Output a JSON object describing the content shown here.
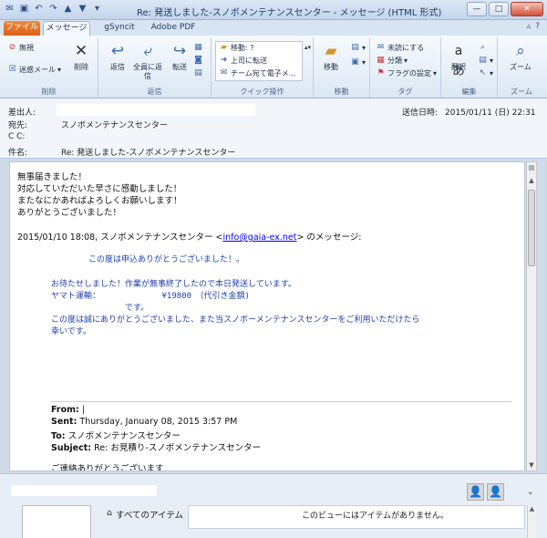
{
  "window": {
    "title": "Re: 発送しました-スノボメンテナンスセンター - メッセージ (HTML 形式)"
  },
  "tabs": {
    "file": "ファイル",
    "message": "メッセージ",
    "gsyncit": "gSyncit",
    "adobe": "Adobe PDF"
  },
  "ribbon": {
    "delete_group": {
      "ignore": "無視",
      "junk": "迷惑メール",
      "delete": "削除",
      "label": "削除"
    },
    "reply_group": {
      "reply": "返信",
      "reply_all": "全員に返信",
      "forward": "転送",
      "label": "返信"
    },
    "quick_group": {
      "move_to": "移動: ?",
      "to_manager": "上司に転送",
      "team_email": "チーム宛て電子メ...",
      "label": "クイック操作"
    },
    "move_group": {
      "move": "移動",
      "label": "移動"
    },
    "tags_group": {
      "unread": "未読にする",
      "categorize": "分類",
      "flag": "フラグの設定",
      "label": "タグ"
    },
    "edit_group": {
      "translate": "翻訳",
      "label": "編集"
    },
    "zoom_group": {
      "zoom": "ズーム",
      "label": "ズーム"
    }
  },
  "header": {
    "from_label": "差出人:",
    "to_label": "宛先:",
    "to_value": "スノボメンテナンスセンター",
    "cc_label": "C C:",
    "subject_label": "件名:",
    "subject_value": "Re: 発送しました-スノボメンテナンスセンター",
    "sent_label": "送信日時:",
    "sent_value": "2015/01/11 (日) 22:31"
  },
  "body": {
    "line1": "無事届きました！",
    "line2": "対応していただいた早さに感動しました！",
    "line3": "またなにかあればよろしくお願いします！",
    "line4": "ありがとうございました！",
    "quote_header_prefix": "2015/01/10 18:08, スノボメンテナンスセンター <",
    "quote_header_link": "info@gaia-ex.net",
    "quote_header_suffix": "> のメッセージ:",
    "q1": "この度は申込ありがとうございました！。",
    "q2": "お待たせしました！作業が無事終了したので本日発送しています。",
    "q3": "ヤマト運輸：　　　　　　　　¥19800　（代引き金額)",
    "q4": "　　　　　　　　　です。",
    "q5": "この度は誠にありがとうございました、また当スノボーメンテナンスセンターをご利用いただけたら",
    "q6": "幸いです。",
    "from_label": "From:",
    "from_value": "|",
    "sent_label": "Sent:",
    "sent_value": "Thursday, January 08, 2015 3:57 PM",
    "to_label": "To:",
    "to_value": "スノボメンテナンスセンター",
    "subject_label": "Subject:",
    "subject_value": "Re: お見積り-スノボメンテナンスセンター",
    "closing": "ご連絡ありがとうございます"
  },
  "people_pane": {
    "all_items": "すべてのアイテム",
    "no_items": "このビューにはアイテムがありません。"
  }
}
